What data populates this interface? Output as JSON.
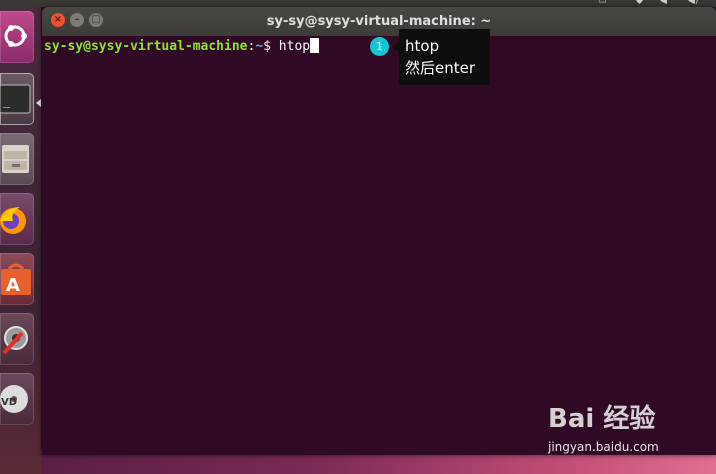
{
  "window": {
    "title": "sy-sy@sysy-virtual-machine: ~"
  },
  "terminal": {
    "user_host": "sy-sy@sysy-virtual-machine",
    "separator": ":",
    "path": "~",
    "prompt_symbol": "$",
    "command": " htop"
  },
  "annotation": {
    "step": "1",
    "line1": "htop",
    "line2": "然后enter"
  },
  "launcher": {
    "items": [
      "ubuntu-icon",
      "terminal-icon",
      "files-icon",
      "firefox-icon",
      "software-center-icon",
      "settings-icon",
      "dvd-icon"
    ]
  },
  "watermark": {
    "brand": "Bai 经验",
    "url": "jingyan.baidu.com"
  },
  "colors": {
    "terminal_bg": "#300a24",
    "prompt_user": "#8ae234",
    "prompt_path": "#729fcf",
    "badge": "#16c5d3",
    "close_button": "#e9542f"
  }
}
